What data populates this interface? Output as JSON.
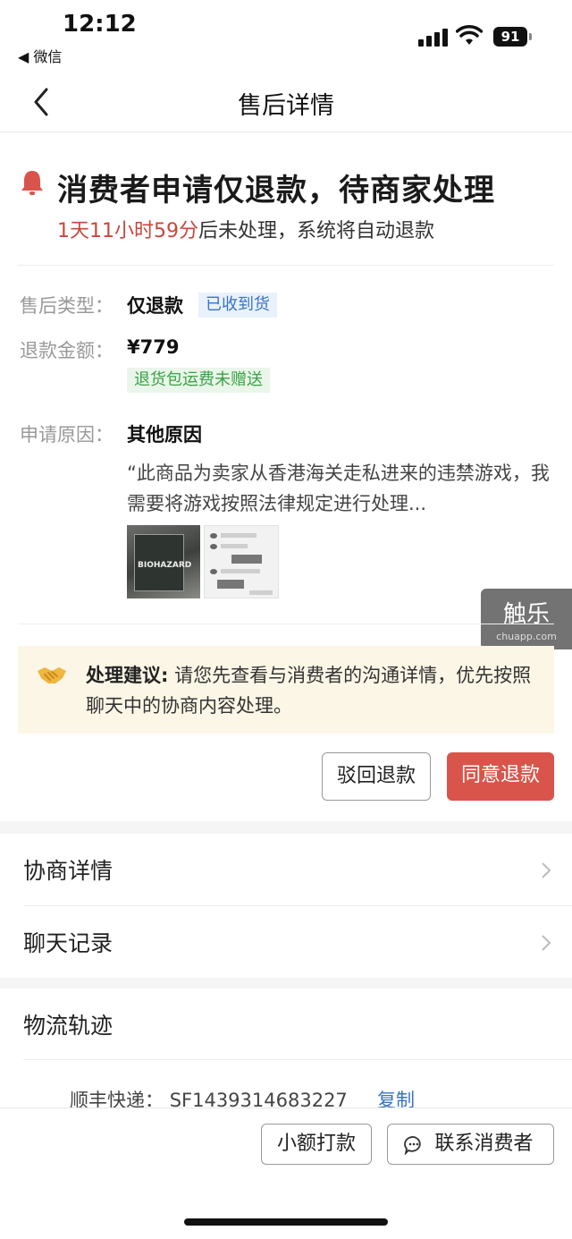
{
  "status_bar": {
    "time": "12:12",
    "back_app": "◀ 微信",
    "battery": "91"
  },
  "nav": {
    "title": "售后详情"
  },
  "header": {
    "headline": "消费者申请仅退款，待商家处理",
    "countdown_highlight": "1天11小时59分",
    "countdown_rest": "后未处理，系统将自动退款"
  },
  "details": {
    "type_label": "售后类型：",
    "type_value": "仅退款",
    "type_tag": "已收到货",
    "amount_label": "退款金额：",
    "amount_value": "¥779",
    "amount_tag": "退货包运费未赠送",
    "reason_label": "申请原因：",
    "reason_value": "其他原因",
    "reason_text": "“此商品为卖家从香港海关走私进来的违禁游戏，我需要将游戏按照法律规定进行处理...",
    "thumb_caption": "BIOHAZARD"
  },
  "watermark": {
    "main": "触乐",
    "sub": "chuapp.com"
  },
  "advice": {
    "prefix": "处理建议:",
    "text": " 请您先查看与消费者的沟通详情，优先按照聊天中的协商内容处理。"
  },
  "actions": {
    "reject_label": "驳回退款",
    "agree_label": "同意退款"
  },
  "list": {
    "negotiation_label": "协商详情",
    "chat_label": "聊天记录",
    "logistics_label": "物流轨迹"
  },
  "logistics": {
    "carrier_label": "顺丰快递：",
    "tracking_number": "SF1439314683227",
    "copy_label": "复制"
  },
  "bottom": {
    "small_payment_label": "小额打款",
    "contact_label": "联系消费者"
  },
  "colors": {
    "accent_red": "#d9544a",
    "countdown_red": "#c9463c",
    "tag_blue": "#3a72c4",
    "tag_green": "#3aa146",
    "advice_bg": "#fbf6e6"
  }
}
